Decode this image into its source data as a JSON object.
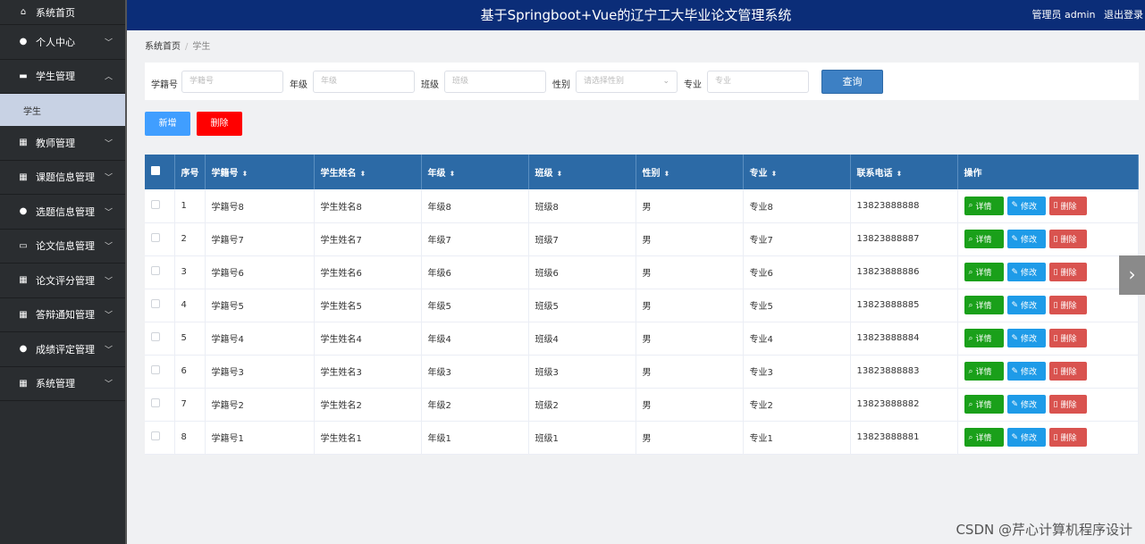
{
  "header": {
    "title": "基于Springboot+Vue的辽宁工大毕业论文管理系统",
    "user": "管理员 admin",
    "logout": "退出登录"
  },
  "sidebar": {
    "items": [
      {
        "label": "系统首页",
        "icon": "home-icon"
      },
      {
        "label": "个人中心",
        "icon": "user-icon"
      },
      {
        "label": "学生管理",
        "icon": "id-card-icon",
        "expanded": true,
        "sub": [
          "学生"
        ]
      },
      {
        "label": "教师管理",
        "icon": "grid-icon"
      },
      {
        "label": "课题信息管理",
        "icon": "grid-icon"
      },
      {
        "label": "选题信息管理",
        "icon": "bulb-icon"
      },
      {
        "label": "论文信息管理",
        "icon": "monitor-icon"
      },
      {
        "label": "论文评分管理",
        "icon": "grid-icon"
      },
      {
        "label": "答辩通知管理",
        "icon": "grid-icon"
      },
      {
        "label": "成绩评定管理",
        "icon": "user-icon"
      },
      {
        "label": "系统管理",
        "icon": "grid-icon"
      }
    ]
  },
  "breadcrumb": {
    "home": "系统首页",
    "current": "学生"
  },
  "search": {
    "fields": [
      {
        "label": "学籍号",
        "placeholder": "学籍号"
      },
      {
        "label": "年级",
        "placeholder": "年级"
      },
      {
        "label": "班级",
        "placeholder": "班级"
      },
      {
        "label": "性别",
        "placeholder": "请选择性别"
      },
      {
        "label": "专业",
        "placeholder": "专业"
      }
    ],
    "button": "查询"
  },
  "actions": {
    "add": "新增",
    "delete": "删除"
  },
  "table": {
    "headers": [
      "序号",
      "学籍号",
      "学生姓名",
      "年级",
      "班级",
      "性别",
      "专业",
      "联系电话",
      "操作"
    ],
    "rows": [
      [
        "1",
        "学籍号8",
        "学生姓名8",
        "年级8",
        "班级8",
        "男",
        "专业8",
        "13823888888"
      ],
      [
        "2",
        "学籍号7",
        "学生姓名7",
        "年级7",
        "班级7",
        "男",
        "专业7",
        "13823888887"
      ],
      [
        "3",
        "学籍号6",
        "学生姓名6",
        "年级6",
        "班级6",
        "男",
        "专业6",
        "13823888886"
      ],
      [
        "4",
        "学籍号5",
        "学生姓名5",
        "年级5",
        "班级5",
        "男",
        "专业5",
        "13823888885"
      ],
      [
        "5",
        "学籍号4",
        "学生姓名4",
        "年级4",
        "班级4",
        "男",
        "专业4",
        "13823888884"
      ],
      [
        "6",
        "学籍号3",
        "学生姓名3",
        "年级3",
        "班级3",
        "男",
        "专业3",
        "13823888883"
      ],
      [
        "7",
        "学籍号2",
        "学生姓名2",
        "年级2",
        "班级2",
        "男",
        "专业2",
        "13823888882"
      ],
      [
        "8",
        "学籍号1",
        "学生姓名1",
        "年级1",
        "班级1",
        "男",
        "专业1",
        "13823888881"
      ]
    ],
    "ops": {
      "detail": "详情",
      "edit": "修改",
      "delete": "删除"
    }
  },
  "watermark": "CSDN @芹心计算机程序设计"
}
